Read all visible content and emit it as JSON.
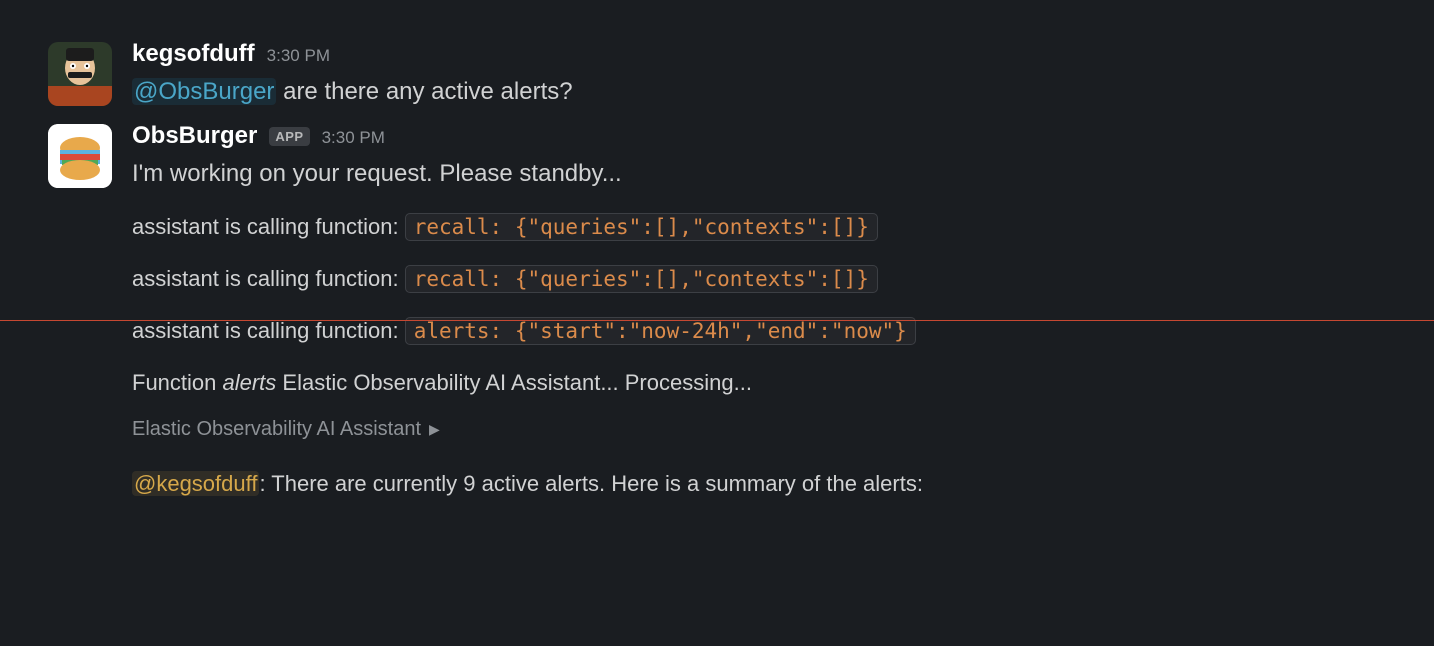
{
  "messages": {
    "m1": {
      "author": "kegsofduff",
      "time": "3:30 PM",
      "mention": "@ObsBurger",
      "text_after_mention": " are there any active alerts?"
    },
    "m2": {
      "author": "ObsBurger",
      "app_badge": "APP",
      "time": "3:30 PM",
      "line1": "I'm working on your request. Please standby...",
      "fn_prefix": "assistant is calling function: ",
      "fn1_code": "recall: {\"queries\":[],\"contexts\":[]}",
      "fn2_code": "recall: {\"queries\":[],\"contexts\":[]}",
      "fn3_code": "alerts: {\"start\":\"now-24h\",\"end\":\"now\"}",
      "processing_prefix": "Function ",
      "processing_italic": "alerts",
      "processing_suffix": " Elastic Observability AI Assistant... Processing...",
      "attachment_label": "Elastic Observability AI Assistant",
      "reply_mention": "@kegsofduff",
      "reply_text": ": There are currently 9 active alerts. Here is a summary of the alerts:"
    }
  }
}
